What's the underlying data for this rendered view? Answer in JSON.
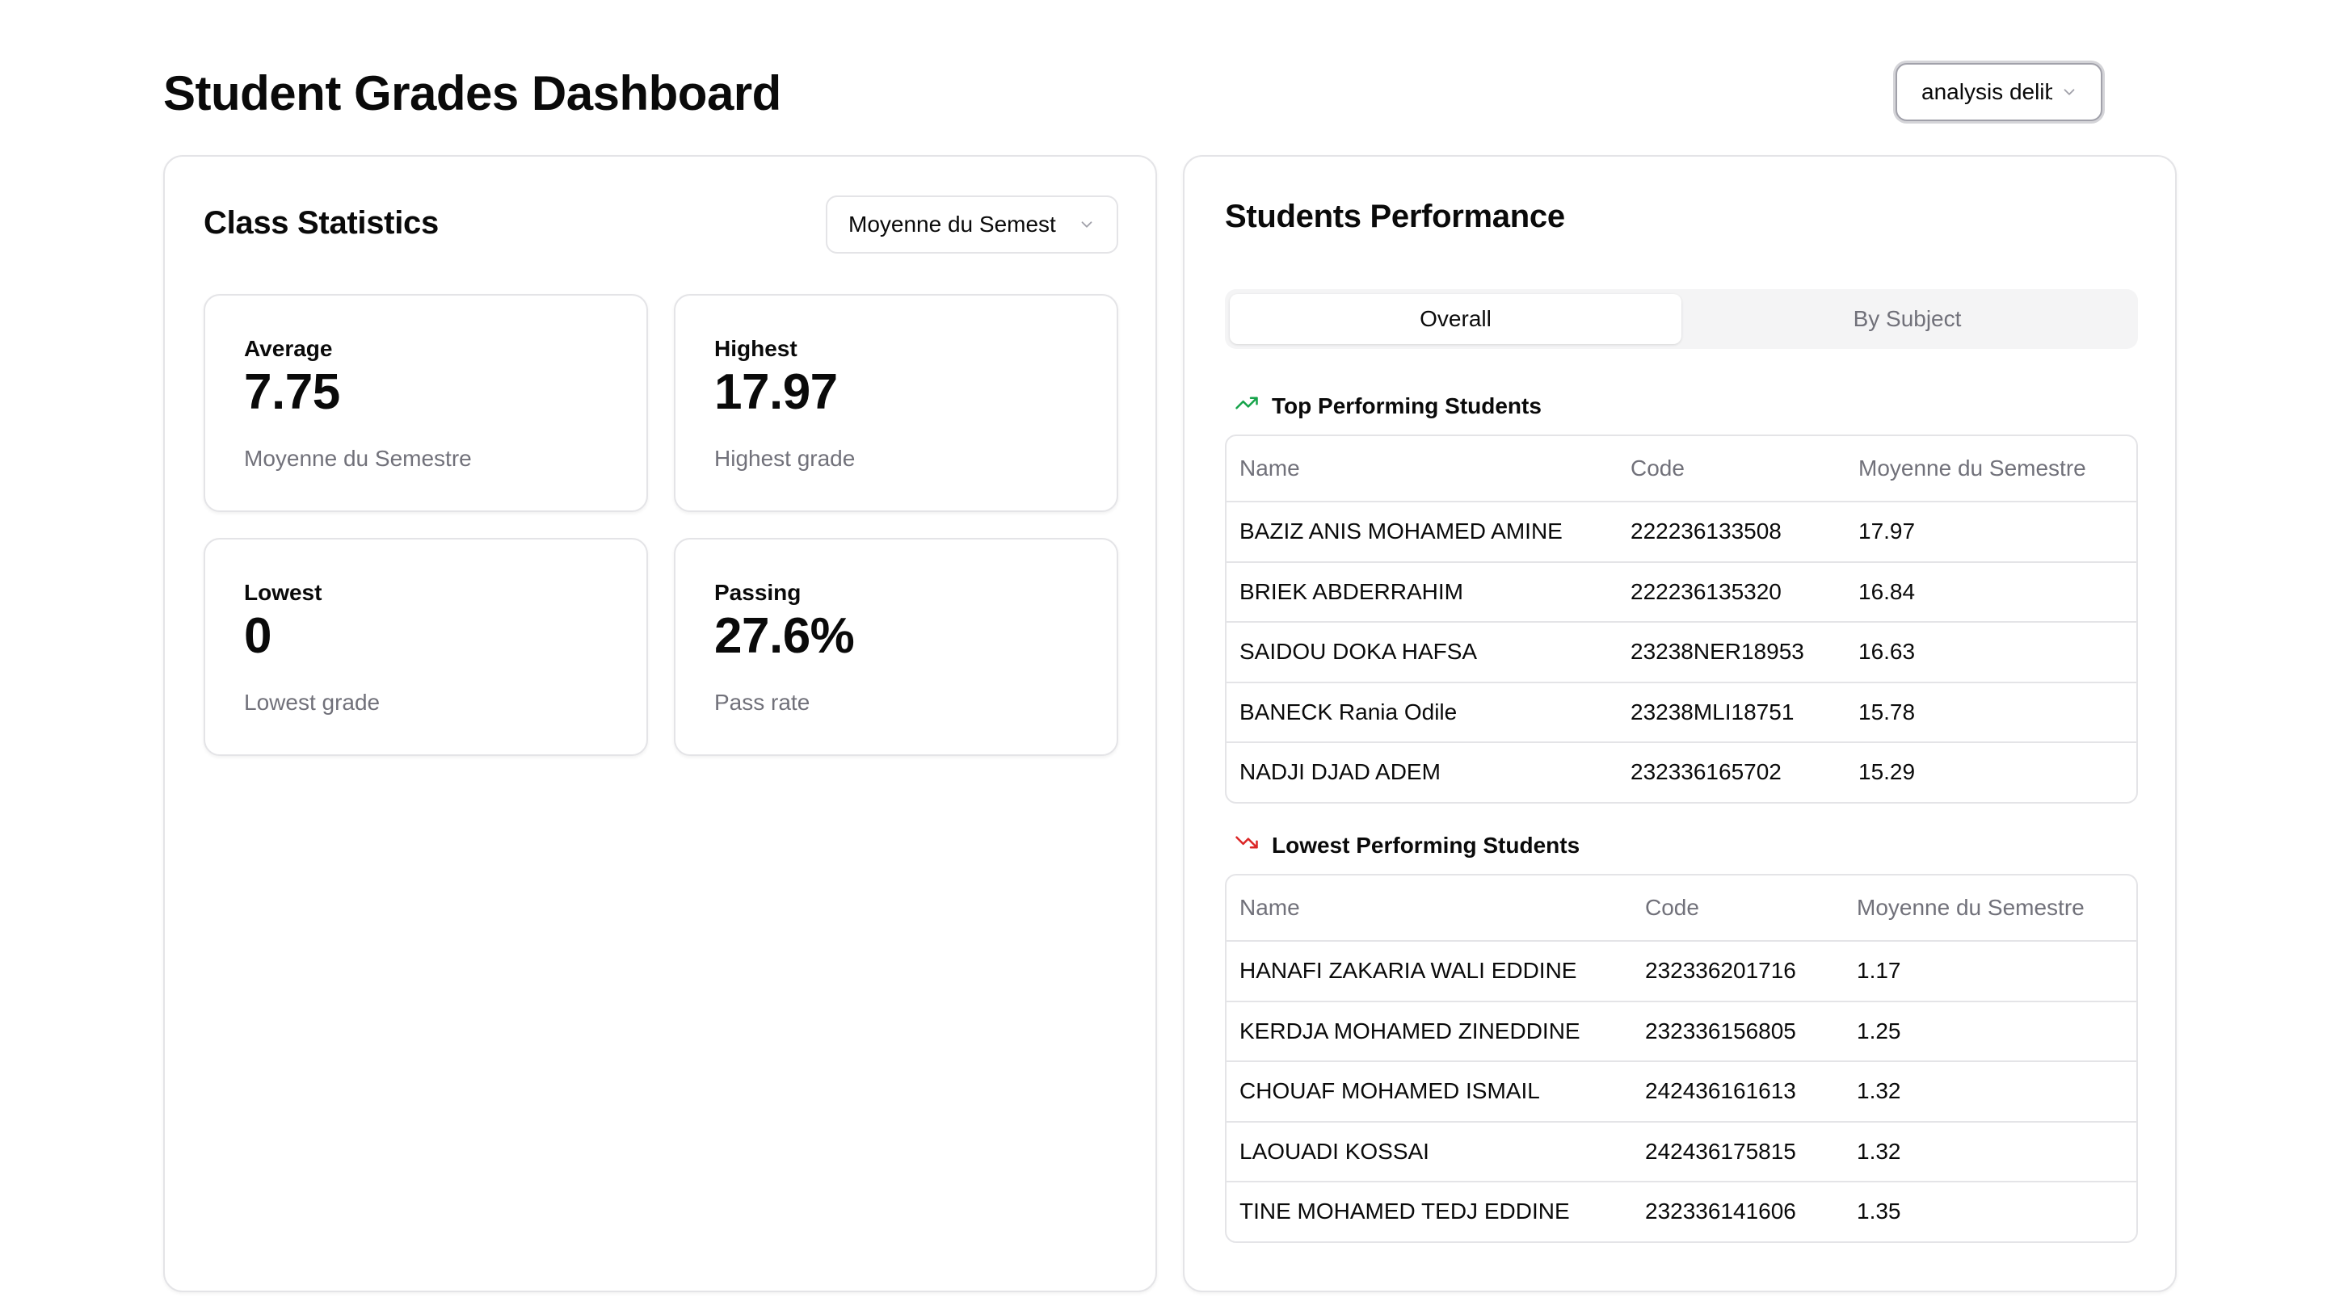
{
  "page": {
    "title": "Student Grades Dashboard",
    "analysis_select": "analysis deliberation"
  },
  "class_stats": {
    "title": "Class Statistics",
    "select_value": "Moyenne du Semest",
    "cards": [
      {
        "label": "Average",
        "value": "7.75",
        "desc": "Moyenne du Semestre"
      },
      {
        "label": "Highest",
        "value": "17.97",
        "desc": "Highest grade"
      },
      {
        "label": "Lowest",
        "value": "0",
        "desc": "Lowest grade"
      },
      {
        "label": "Passing",
        "value": "27.6%",
        "desc": "Pass rate"
      }
    ]
  },
  "performance": {
    "title": "Students Performance",
    "tabs": [
      {
        "label": "Overall",
        "active": true
      },
      {
        "label": "By Subject",
        "active": false
      }
    ],
    "top": {
      "heading": "Top Performing Students",
      "icon": "trending-up-icon",
      "columns": [
        "Name",
        "Code",
        "Moyenne du Semestre"
      ],
      "rows": [
        [
          "BAZIZ ANIS MOHAMED AMINE",
          "222236133508",
          "17.97"
        ],
        [
          "BRIEK ABDERRAHIM",
          "222236135320",
          "16.84"
        ],
        [
          "SAIDOU DOKA HAFSA",
          "23238NER18953",
          "16.63"
        ],
        [
          "BANECK Rania Odile",
          "23238MLI18751",
          "15.78"
        ],
        [
          "NADJI DJAD ADEM",
          "232336165702",
          "15.29"
        ]
      ]
    },
    "lowest": {
      "heading": "Lowest Performing Students",
      "icon": "trending-down-icon",
      "columns": [
        "Name",
        "Code",
        "Moyenne du Semestre"
      ],
      "rows": [
        [
          "HANAFI ZAKARIA WALI EDDINE",
          "232336201716",
          "1.17"
        ],
        [
          "KERDJA MOHAMED ZINEDDINE",
          "232336156805",
          "1.25"
        ],
        [
          "CHOUAF MOHAMED ISMAIL",
          "242436161613",
          "1.32"
        ],
        [
          "LAOUADI KOSSAI",
          "242436175815",
          "1.32"
        ],
        [
          "TINE MOHAMED TEDJ EDDINE",
          "232336141606",
          "1.35"
        ]
      ]
    }
  },
  "colors": {
    "trend_up": "#16a34a",
    "trend_down": "#dc2626",
    "border": "#e4e4e7",
    "muted_text": "#71717a"
  }
}
